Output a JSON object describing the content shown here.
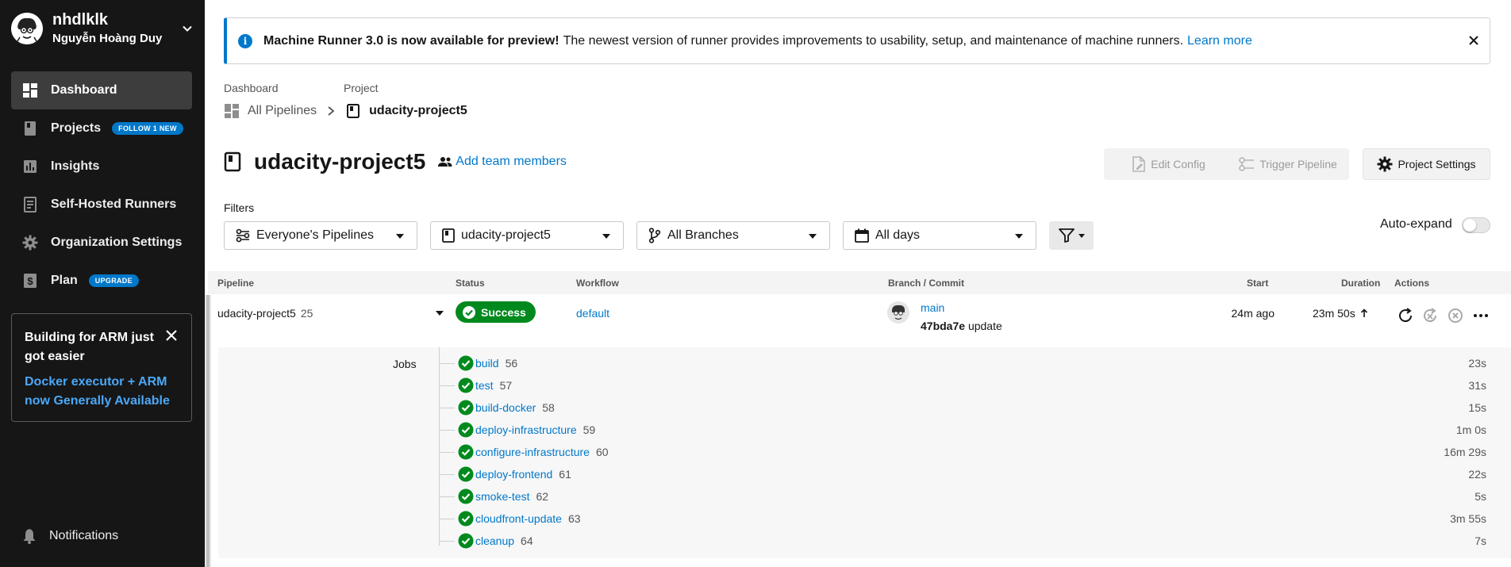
{
  "user": {
    "login": "nhdlklk",
    "full_name": "Nguyễn Hoàng Duy"
  },
  "sidebar": {
    "items": [
      {
        "label": "Dashboard",
        "icon": "dashboard-icon",
        "active": true
      },
      {
        "label": "Projects",
        "icon": "projects-icon",
        "badge": "FOLLOW 1 NEW"
      },
      {
        "label": "Insights",
        "icon": "insights-icon"
      },
      {
        "label": "Self-Hosted Runners",
        "icon": "runners-icon"
      },
      {
        "label": "Organization Settings",
        "icon": "gear-icon"
      },
      {
        "label": "Plan",
        "icon": "dollar-icon",
        "badge": "UPGRADE"
      }
    ],
    "promo": {
      "title": "Building for ARM just got easier",
      "link": "Docker executor + ARM now Generally Available"
    },
    "notifications": "Notifications"
  },
  "banner": {
    "title": "Machine Runner 3.0 is now available for preview!",
    "text": "The newest version of runner provides improvements to usability, setup, and maintenance of machine runners.",
    "link": "Learn more"
  },
  "breadcrumb": {
    "dashboard_label": "Dashboard",
    "project_label": "Project",
    "all_pipelines": "All Pipelines",
    "project": "udacity-project5"
  },
  "header": {
    "project_title": "udacity-project5",
    "add_team": "Add team members",
    "edit_config": "Edit Config",
    "trigger_pipeline": "Trigger Pipeline",
    "project_settings": "Project Settings"
  },
  "filters": {
    "label": "Filters",
    "pipelines": "Everyone's Pipelines",
    "project": "udacity-project5",
    "branches": "All Branches",
    "days": "All days",
    "auto_expand": "Auto-expand"
  },
  "table": {
    "columns": {
      "pipeline": "Pipeline",
      "status": "Status",
      "workflow": "Workflow",
      "branch": "Branch / Commit",
      "start": "Start",
      "duration": "Duration",
      "actions": "Actions"
    },
    "row": {
      "pipeline": "udacity-project5",
      "number": "25",
      "status": "Success",
      "workflow": "default",
      "branch": "main",
      "commit_hash": "47bda7e",
      "commit_msg": "update",
      "start": "24m ago",
      "duration": "23m 50s"
    },
    "jobs_label": "Jobs",
    "jobs": [
      {
        "name": "build",
        "number": "56",
        "duration": "23s"
      },
      {
        "name": "test",
        "number": "57",
        "duration": "31s"
      },
      {
        "name": "build-docker",
        "number": "58",
        "duration": "15s"
      },
      {
        "name": "deploy-infrastructure",
        "number": "59",
        "duration": "1m 0s"
      },
      {
        "name": "configure-infrastructure",
        "number": "60",
        "duration": "16m 29s"
      },
      {
        "name": "deploy-frontend",
        "number": "61",
        "duration": "22s"
      },
      {
        "name": "smoke-test",
        "number": "62",
        "duration": "5s"
      },
      {
        "name": "cloudfront-update",
        "number": "63",
        "duration": "3m 55s"
      },
      {
        "name": "cleanup",
        "number": "64",
        "duration": "7s"
      }
    ]
  },
  "colors": {
    "sidebar_bg": "#161616",
    "accent": "#0078ca",
    "success": "#008a1e"
  }
}
